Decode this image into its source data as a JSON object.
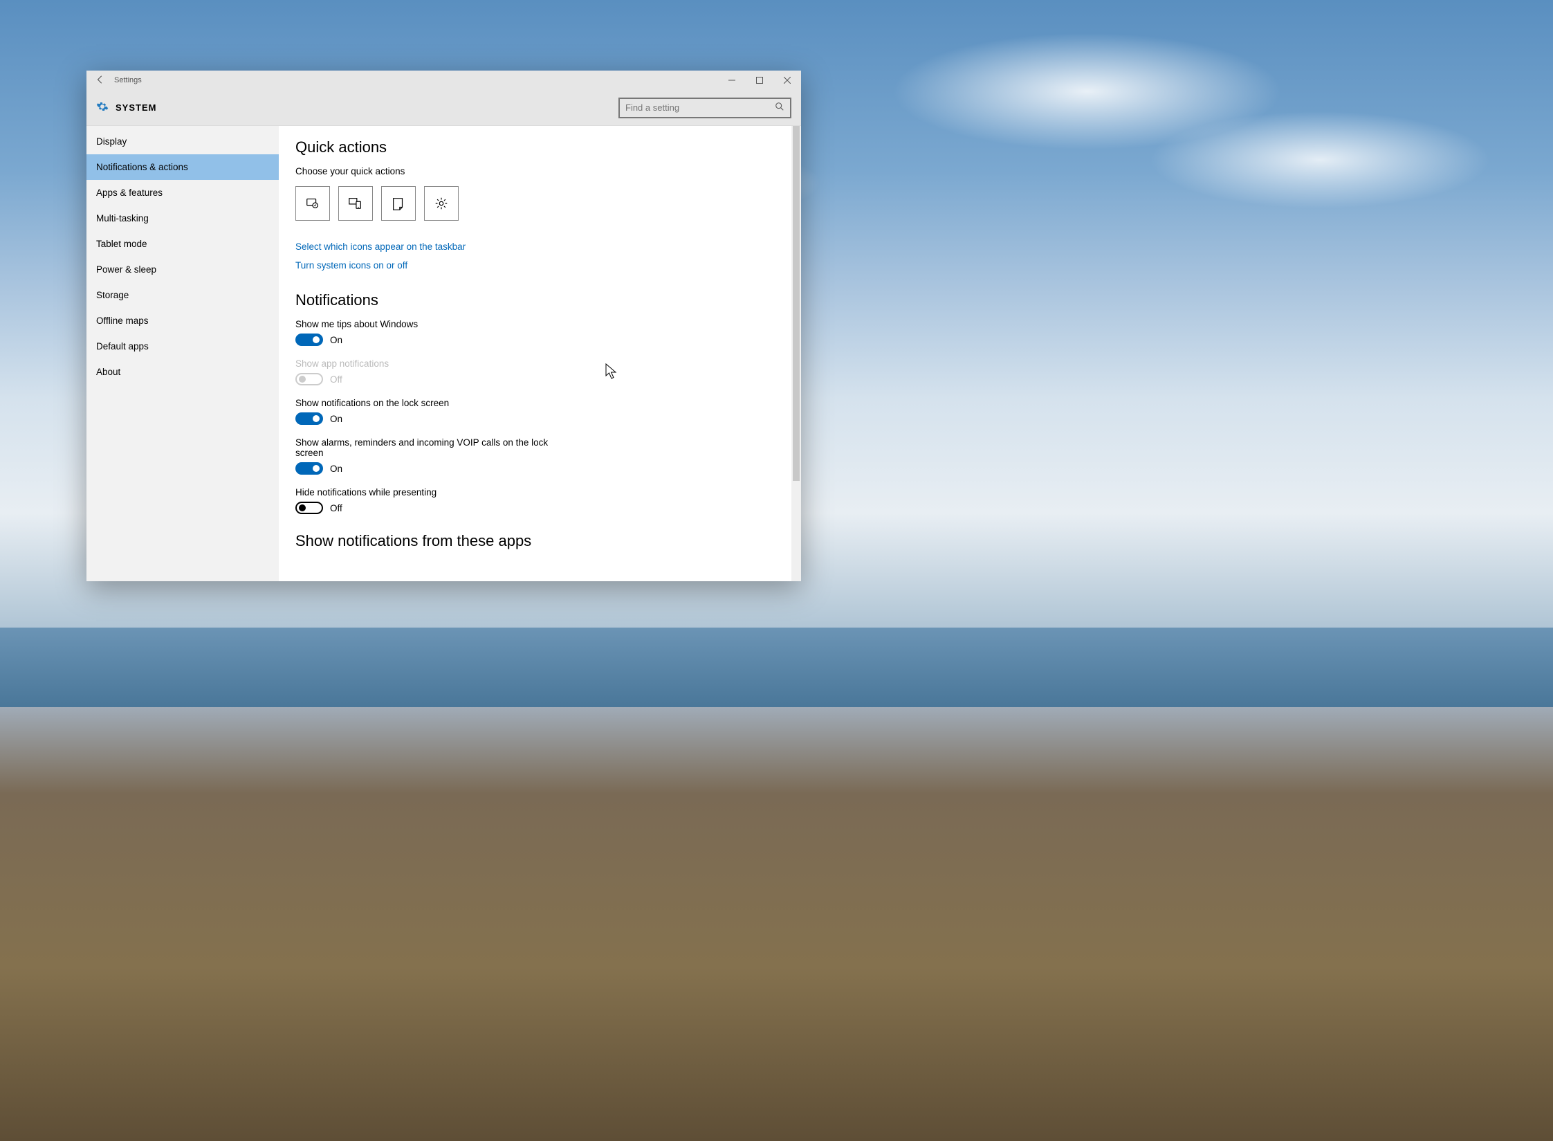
{
  "titlebar": {
    "app_name": "Settings"
  },
  "header": {
    "section": "SYSTEM",
    "search_placeholder": "Find a setting"
  },
  "sidebar": {
    "items": [
      {
        "label": "Display",
        "selected": false
      },
      {
        "label": "Notifications & actions",
        "selected": true
      },
      {
        "label": "Apps & features",
        "selected": false
      },
      {
        "label": "Multi-tasking",
        "selected": false
      },
      {
        "label": "Tablet mode",
        "selected": false
      },
      {
        "label": "Power & sleep",
        "selected": false
      },
      {
        "label": "Storage",
        "selected": false
      },
      {
        "label": "Offline maps",
        "selected": false
      },
      {
        "label": "Default apps",
        "selected": false
      },
      {
        "label": "About",
        "selected": false
      }
    ]
  },
  "content": {
    "quick_actions": {
      "heading": "Quick actions",
      "subheading": "Choose your quick actions",
      "tiles": [
        "tablet-mode",
        "connect",
        "note",
        "all-settings"
      ],
      "link_taskbar": "Select which icons appear on the taskbar",
      "link_system_icons": "Turn system icons on or off"
    },
    "notifications": {
      "heading": "Notifications",
      "toggles": [
        {
          "label": "Show me tips about Windows",
          "state": "On",
          "on": true,
          "disabled": false
        },
        {
          "label": "Show app notifications",
          "state": "Off",
          "on": false,
          "disabled": true
        },
        {
          "label": "Show notifications on the lock screen",
          "state": "On",
          "on": true,
          "disabled": false
        },
        {
          "label": "Show alarms, reminders and incoming VOIP calls on the lock screen",
          "state": "On",
          "on": true,
          "disabled": false
        },
        {
          "label": "Hide notifications while presenting",
          "state": "Off",
          "on": false,
          "disabled": false
        }
      ]
    },
    "apps_heading": "Show notifications from these apps"
  }
}
